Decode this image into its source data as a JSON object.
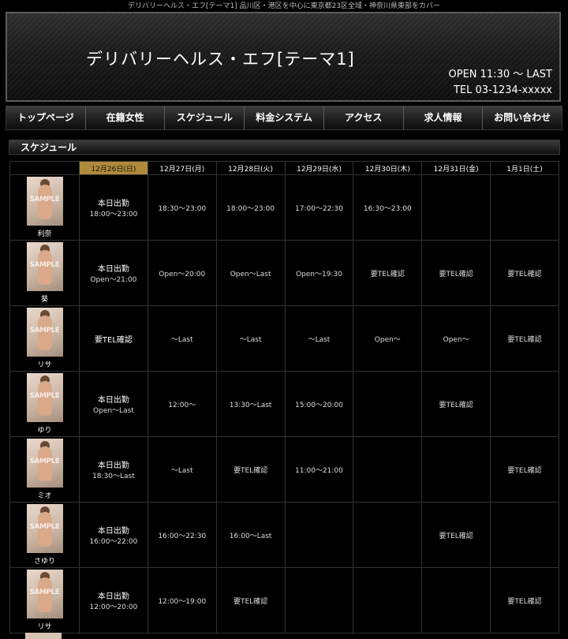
{
  "topline": "デリバリーヘルス・エフ[テーマ1] 品川区・港区を中心に東京都23区全域・神奈川県東部をカバー",
  "header": {
    "title": "デリバリーヘルス・エフ[テーマ1]",
    "open": "OPEN 11:30 ～ LAST",
    "tel": "TEL 03-1234-xxxxx"
  },
  "nav": [
    {
      "label": "トップページ"
    },
    {
      "label": "在籍女性"
    },
    {
      "label": "スケジュール"
    },
    {
      "label": "料金システム"
    },
    {
      "label": "アクセス"
    },
    {
      "label": "求人情報"
    },
    {
      "label": "お問い合わせ"
    }
  ],
  "section_title": "スケジュール",
  "watermark": "SAMPLE",
  "dates": [
    "12月26日(日)",
    "12月27日(月)",
    "12月28日(火)",
    "12月29日(水)",
    "12月30日(木)",
    "12月31日(金)",
    "1月1日(土)"
  ],
  "rows": [
    {
      "name": "利奈",
      "today_main": "本日出勤",
      "today_sub": "18:00～23:00",
      "days": [
        "18:30～23:00",
        "18:00～23:00",
        "17:00～22:30",
        "16:30～23:00",
        "",
        ""
      ]
    },
    {
      "name": "葵",
      "today_main": "本日出勤",
      "today_sub": "Open～21:00",
      "days": [
        "Open～20:00",
        "Open～Last",
        "Open～19:30",
        "要TEL確認",
        "要TEL確認",
        "要TEL確認"
      ]
    },
    {
      "name": "リサ",
      "today_main": "要TEL確認",
      "today_sub": "",
      "days": [
        "～Last",
        "～Last",
        "～Last",
        "Open～",
        "Open～",
        "要TEL確認"
      ]
    },
    {
      "name": "ゆり",
      "today_main": "本日出勤",
      "today_sub": "Open～Last",
      "days": [
        "12:00～",
        "13:30～Last",
        "15:00～20:00",
        "",
        "要TEL確認",
        ""
      ]
    },
    {
      "name": "ミオ",
      "today_main": "本日出勤",
      "today_sub": "18:30～Last",
      "days": [
        "～Last",
        "要TEL確認",
        "11:00～21:00",
        "",
        "",
        "要TEL確認"
      ]
    },
    {
      "name": "さゆり",
      "today_main": "本日出勤",
      "today_sub": "16:00～22:00",
      "days": [
        "16:00～22:30",
        "16:00～Last",
        "",
        "",
        "要TEL確認",
        ""
      ]
    },
    {
      "name": "リサ",
      "today_main": "本日出勤",
      "today_sub": "12:00～20:00",
      "days": [
        "12:00～19:00",
        "要TEL確認",
        "",
        "",
        "",
        "要TEL確認"
      ]
    }
  ]
}
